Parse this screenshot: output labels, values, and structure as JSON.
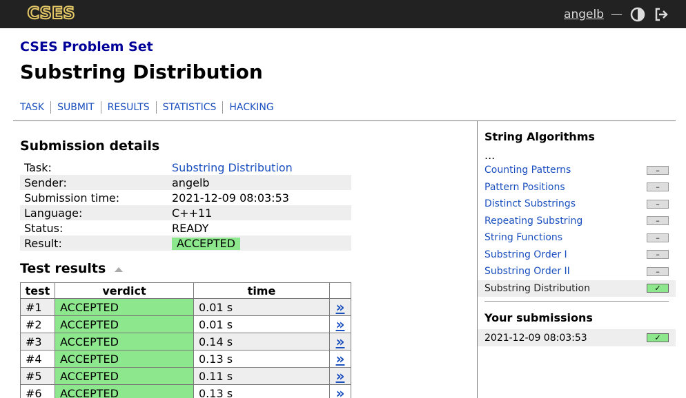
{
  "header": {
    "logo_text": "CSES",
    "username": "angelb",
    "separator": "—",
    "icons": [
      "contrast-icon",
      "logout-icon"
    ]
  },
  "page": {
    "set_title": "CSES Problem Set",
    "problem_title": "Substring Distribution"
  },
  "nav": [
    "TASK",
    "SUBMIT",
    "RESULTS",
    "STATISTICS",
    "HACKING"
  ],
  "details": {
    "title": "Submission details",
    "rows": [
      {
        "key": "Task:",
        "value": "Substring Distribution",
        "link": true
      },
      {
        "key": "Sender:",
        "value": "angelb"
      },
      {
        "key": "Submission time:",
        "value": "2021-12-09 08:03:53"
      },
      {
        "key": "Language:",
        "value": "C++11"
      },
      {
        "key": "Status:",
        "value": "READY"
      },
      {
        "key": "Result:",
        "value": "ACCEPTED",
        "badge": true
      }
    ]
  },
  "results": {
    "title": "Test results",
    "columns": [
      "test",
      "verdict",
      "time",
      ""
    ],
    "link_glyph": "»",
    "rows": [
      {
        "test": "#1",
        "verdict": "ACCEPTED",
        "time": "0.01 s"
      },
      {
        "test": "#2",
        "verdict": "ACCEPTED",
        "time": "0.01 s"
      },
      {
        "test": "#3",
        "verdict": "ACCEPTED",
        "time": "0.14 s"
      },
      {
        "test": "#4",
        "verdict": "ACCEPTED",
        "time": "0.13 s"
      },
      {
        "test": "#5",
        "verdict": "ACCEPTED",
        "time": "0.11 s"
      },
      {
        "test": "#6",
        "verdict": "ACCEPTED",
        "time": "0.13 s"
      }
    ]
  },
  "sidebar": {
    "title": "String Algorithms",
    "ellipsis": "...",
    "items": [
      {
        "label": "Counting Patterns",
        "status": "–"
      },
      {
        "label": "Pattern Positions",
        "status": "–"
      },
      {
        "label": "Distinct Substrings",
        "status": "–"
      },
      {
        "label": "Repeating Substring",
        "status": "–"
      },
      {
        "label": "String Functions",
        "status": "–"
      },
      {
        "label": "Substring Order I",
        "status": "–"
      },
      {
        "label": "Substring Order II",
        "status": "–"
      },
      {
        "label": "Substring Distribution",
        "status": "✓",
        "current": true
      }
    ],
    "submissions_title": "Your submissions",
    "submissions": [
      {
        "time": "2021-12-09 08:03:53",
        "status": "✓"
      }
    ]
  },
  "colors": {
    "topbar": "#222222",
    "link": "#1a4fbf",
    "set_title": "#000099",
    "accepted": "#8de88d",
    "row_alt": "#eeeeee"
  }
}
